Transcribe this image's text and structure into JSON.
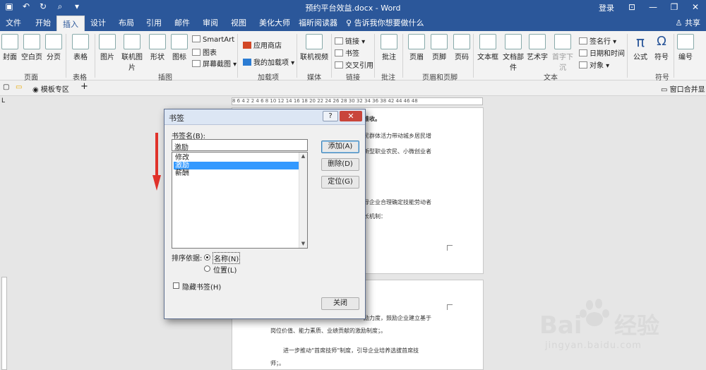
{
  "window": {
    "doc_title": "预约平台效益.docx - Word",
    "login": "登录",
    "share": "共享"
  },
  "tabs": [
    "文件",
    "开始",
    "插入",
    "设计",
    "布局",
    "引用",
    "邮件",
    "审阅",
    "视图",
    "美化大师",
    "福昕阅读器"
  ],
  "tell_me": "告诉我你想要做什么",
  "ribbon": {
    "cover": "封面",
    "blank_page": "空白页",
    "page_break": "分页",
    "table": "表格",
    "picture": "图片",
    "online_picture": "联机图片",
    "shapes": "形状",
    "icons": "图标",
    "smartart": "SmartArt",
    "chart": "图表",
    "screenshot": "屏幕截图",
    "store": "应用商店",
    "my_addins": "我的加载项",
    "online_video": "联机视频",
    "link": "链接",
    "bookmark": "书签",
    "cross_ref": "交叉引用",
    "comment": "批注",
    "header": "页眉",
    "footer": "页脚",
    "page_number": "页码",
    "textbox": "文本框",
    "quick_parts": "文档部件",
    "wordart": "艺术字",
    "drop_cap": "首字下沉",
    "signature": "签名行",
    "datetime": "日期和时间",
    "object": "对象",
    "equation": "公式",
    "symbol": "符号",
    "numbering": "编号",
    "groups": {
      "pages": "页面",
      "tables": "表格",
      "illustrations": "插图",
      "addins": "加载项",
      "media": "媒体",
      "links": "链接",
      "comments": "批注",
      "header_footer": "页眉和页脚",
      "text": "文本",
      "symbols": "符号"
    }
  },
  "tabsbar": {
    "template_zone": "模板专区",
    "add": "+",
    "merge": "窗口合并显示"
  },
  "ruler_text": "8  6  4  2       2  4  6  8  10  12  14  16  18  20  22  24  26  28  30  32  34  36  38           42  44  46  48",
  "document": {
    "p1_title": "推收。",
    "p1_line1": "民群体活力带动城乡居民增",
    "p1_line2": "新型职业农民、小微创业者",
    "p1_line3": "导企业合理确定技能劳动者",
    "p1_line4": "长机制：",
    "p2_line1": "励力度，鼓励企业建立基于",
    "p2_line2": "岗位价值、能力素质、业绩贡献的激励制度；。",
    "p2_line3": "进一步推动“首席技师”制度，引导企业培养选拔首席技",
    "p2_line4": "师；。"
  },
  "dialog": {
    "title": "书签",
    "help": "?",
    "close_x": "✕",
    "name_label": "书签名(B):",
    "name_value": "激励",
    "list": [
      "修改",
      "激励",
      "薪酬"
    ],
    "selected_index": 1,
    "btn_add": "添加(A)",
    "btn_delete": "删除(D)",
    "btn_goto": "定位(G)",
    "sort_label": "排序依据:",
    "sort_name": "名称(N)",
    "sort_location": "位置(L)",
    "sort_selected": "名称(N)",
    "hidden_label": "隐藏书签(H)",
    "hidden_checked": false,
    "btn_close": "关闭"
  },
  "watermark": {
    "brand": "Bai",
    "brand2": "经验",
    "url": "jingyan.baidu.com"
  },
  "colors": {
    "title_blue": "#2b579a",
    "selection": "#3399ff",
    "arrow_red": "#e0322b",
    "close_red": "#c9453b"
  }
}
